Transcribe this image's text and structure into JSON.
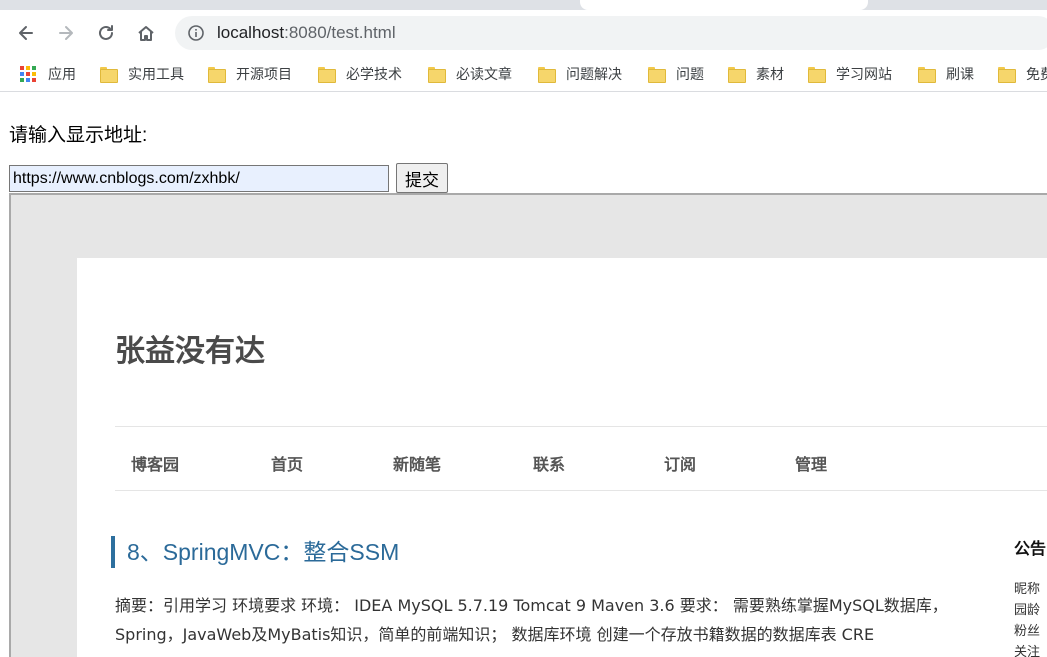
{
  "browser": {
    "url_host": "localhost",
    "url_rest": ":8080/test.html"
  },
  "bookmarks": [
    {
      "label": "应用",
      "icon": "apps-grid-icon"
    },
    {
      "label": "实用工具",
      "icon": "folder-icon"
    },
    {
      "label": "开源项目",
      "icon": "folder-icon"
    },
    {
      "label": "必学技术",
      "icon": "folder-icon"
    },
    {
      "label": "必读文章",
      "icon": "folder-icon"
    },
    {
      "label": "问题解决",
      "icon": "folder-icon"
    },
    {
      "label": "问题",
      "icon": "folder-icon"
    },
    {
      "label": "素材",
      "icon": "folder-icon"
    },
    {
      "label": "学习网站",
      "icon": "folder-icon"
    },
    {
      "label": "刷课",
      "icon": "folder-icon"
    },
    {
      "label": "免费",
      "icon": "folder-icon"
    }
  ],
  "form": {
    "prompt": "请输入显示地址:",
    "address_value": "https://www.cnblogs.com/zxhbk/",
    "submit_label": "提交"
  },
  "blog": {
    "title": "张益没有达",
    "nav": [
      "博客园",
      "首页",
      "新随笔",
      "联系",
      "订阅",
      "管理"
    ],
    "post_title": "8、SpringMVC：整合SSM",
    "post_summary": "摘要：引用学习 环境要求 环境： IDEA MySQL 5.7.19 Tomcat 9 Maven 3.6 要求： 需要熟练掌握MySQL数据库，Spring，JavaWeb及MyBatis知识，简单的前端知识； 数据库环境 创建一个存放书籍数据的数据库表 CRE",
    "sidebar_title": "公告",
    "sidebar_lines": [
      "昵称",
      "园龄",
      "粉丝",
      "关注"
    ]
  },
  "colors": {
    "accent_link": "#2b6a99",
    "input_autofill": "#e8f0fe"
  }
}
